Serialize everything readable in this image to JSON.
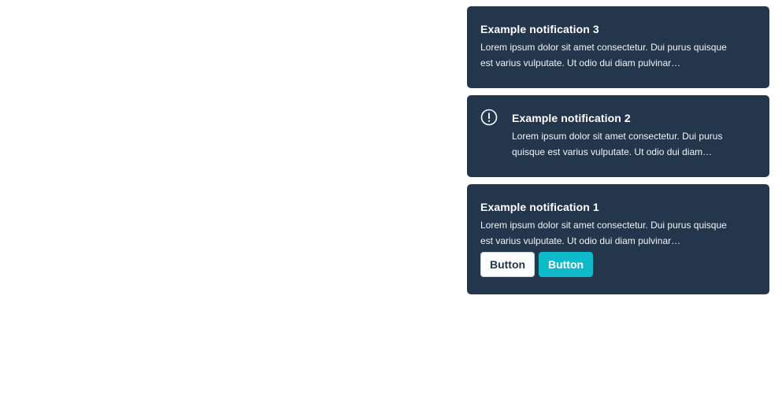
{
  "colors": {
    "toast_background": "#23364c",
    "toast_text": "#ffffff",
    "primary_button": "#0eb9c9",
    "secondary_button": "#ffffff"
  },
  "notifications": [
    {
      "title": "Example notification 3",
      "body": "Lorem ipsum dolor sit amet consectetur. Dui purus quisque est varius vulputate. Ut odio dui diam pulvinar…"
    },
    {
      "icon": "alert-circle-icon",
      "title": "Example notification 2",
      "body": "Lorem ipsum dolor sit amet consectetur. Dui purus quisque est varius vulputate. Ut odio dui diam…"
    },
    {
      "title": "Example notification 1",
      "body": "Lorem ipsum dolor sit amet consectetur. Dui purus quisque est varius vulputate. Ut odio dui diam pulvinar…",
      "buttons": {
        "secondary_label": "Button",
        "primary_label": "Button"
      }
    }
  ]
}
